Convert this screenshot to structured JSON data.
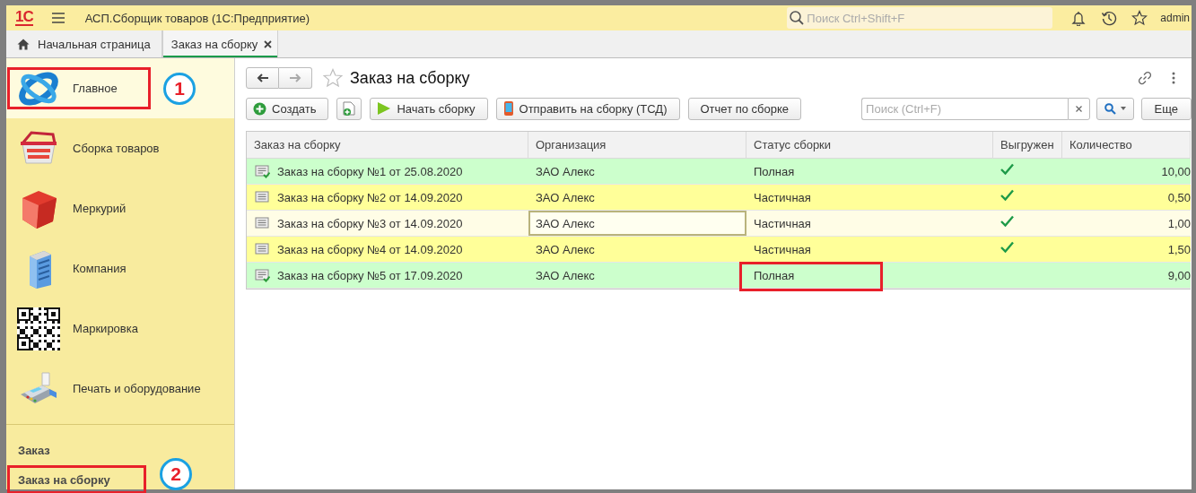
{
  "app": {
    "logo": "1С",
    "title": "АСП.Сборщик товаров  (1С:Предприятие)",
    "search": {
      "placeholder": "Поиск Ctrl+Shift+F"
    },
    "user": "admin"
  },
  "tabs": [
    {
      "label": "Начальная страница",
      "kind": "home",
      "selected": false
    },
    {
      "label": "Заказ на сборку",
      "kind": "closable",
      "selected": true
    }
  ],
  "sidebar": {
    "sections": [
      {
        "label": "Главное",
        "selected": true,
        "highlighted": true,
        "callout": "1"
      },
      {
        "label": "Сборка товаров",
        "selected": false,
        "highlighted": false
      },
      {
        "label": "Меркурий",
        "selected": false,
        "highlighted": false
      },
      {
        "label": "Компания",
        "selected": false,
        "highlighted": false
      },
      {
        "label": "Маркировка",
        "selected": false,
        "highlighted": false
      },
      {
        "label": "Печать и оборудование",
        "selected": false,
        "highlighted": false
      }
    ],
    "commands": [
      {
        "label": "Заказ",
        "highlighted": false
      },
      {
        "label": "Заказ на сборку",
        "highlighted": true,
        "callout": "2"
      }
    ]
  },
  "form": {
    "title": "Заказ на сборку",
    "nav": {
      "back_disabled": false,
      "forward_disabled": true
    },
    "toolbar": [
      {
        "kind": "create",
        "label": "Создать"
      },
      {
        "kind": "copy"
      },
      {
        "kind": "start",
        "label": "Начать сборку"
      },
      {
        "kind": "device",
        "label": "Отправить на сборку (ТСД)"
      },
      {
        "kind": "plain",
        "label": "Отчет по сборке"
      }
    ],
    "search": {
      "placeholder": "Поиск (Ctrl+F)"
    },
    "more": "Еще",
    "table": {
      "columns": [
        "Заказ на сборку",
        "Организация",
        "Статус сборки",
        "Выгружен",
        "Количество"
      ],
      "rows": [
        {
          "kind": "full",
          "posted": true,
          "document": "Заказ на сборку №1 от 25.08.2020",
          "organization": "ЗАО Алекс",
          "status": "Полная",
          "exported": true,
          "quantity": "10,00",
          "selected": false,
          "highlighted": false
        },
        {
          "kind": "partial",
          "posted": false,
          "document": "Заказ на сборку №2 от 14.09.2020",
          "organization": "ЗАО Алекс",
          "status": "Частичная",
          "exported": true,
          "quantity": "0,50",
          "selected": false,
          "highlighted": false
        },
        {
          "kind": "partial",
          "posted": false,
          "document": "Заказ на сборку №3 от 14.09.2020",
          "organization": "ЗАО Алекс",
          "status": "Частичная",
          "exported": true,
          "quantity": "1,00",
          "selected": true,
          "highlighted": false
        },
        {
          "kind": "partial",
          "posted": false,
          "document": "Заказ на сборку №4 от 14.09.2020",
          "organization": "ЗАО Алекс",
          "status": "Частичная",
          "exported": true,
          "quantity": "1,50",
          "selected": false,
          "highlighted": false
        },
        {
          "kind": "full",
          "posted": true,
          "document": "Заказ на сборку №5 от 17.09.2020",
          "organization": "ЗАО Алекс",
          "status": "Полная",
          "exported": false,
          "quantity": "9,00",
          "selected": false,
          "highlighted": true
        }
      ]
    }
  }
}
